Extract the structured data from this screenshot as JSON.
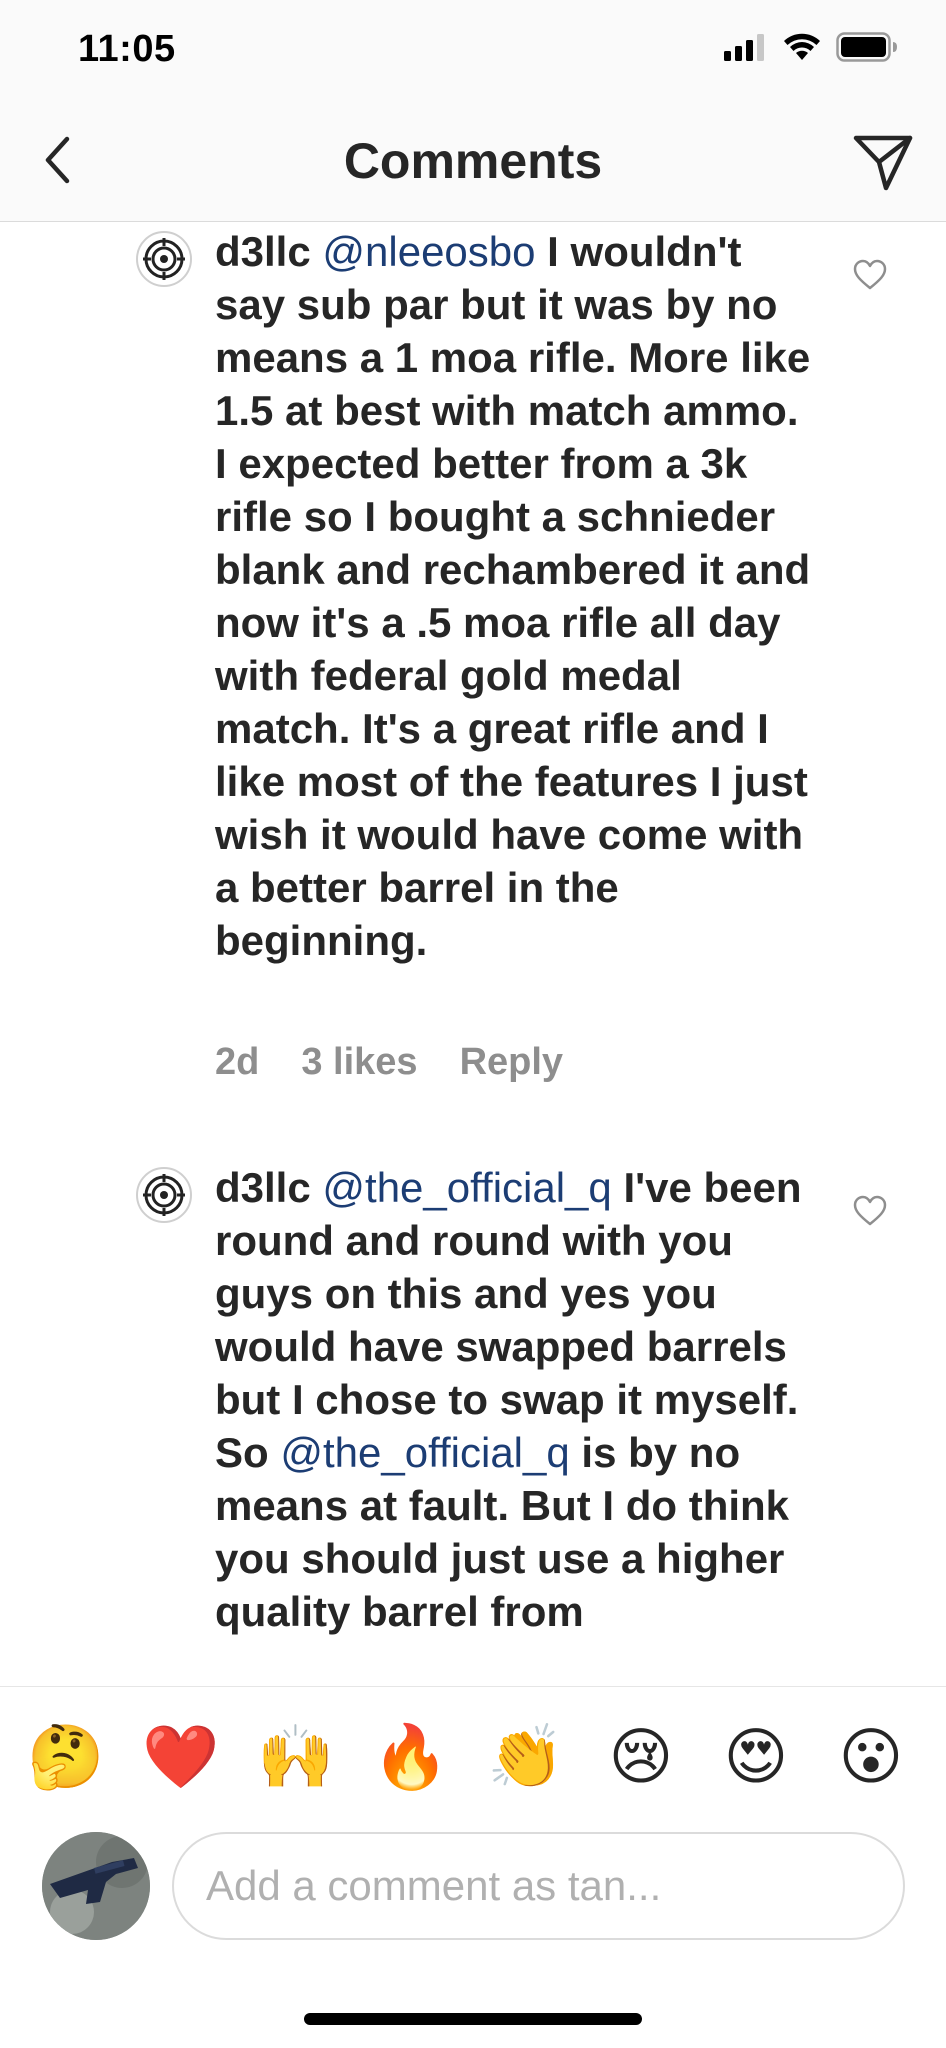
{
  "status_bar": {
    "time": "11:05"
  },
  "header": {
    "title": "Comments"
  },
  "comments": [
    {
      "username": "d3llc",
      "mention": "@nleeosbo",
      "text": " I wouldn't say sub par but it was by no means a 1 moa rifle.  More like 1.5 at best with match ammo.  I expected better from a 3k rifle so I bought a schnieder blank and rechambered it and now it's a .5 moa rifle all day with federal gold medal match.  It's a great rifle and I like most of the features I just wish it would have come with a better barrel in the beginning.",
      "age": "2d",
      "likes": "3 likes",
      "reply": "Reply"
    },
    {
      "username": "d3llc",
      "mention": "@the_official_q",
      "text_part1": " I've been round and round with you guys on this and yes you would have swapped barrels but I chose to swap it myself.  So ",
      "mention2": "@the_official_q",
      "text_part2": " is by no means at fault.  But I do think you should just use a higher quality barrel from"
    }
  ],
  "emoji_bar": [
    {
      "glyph": "🤔",
      "name": "thinking-face-emoji"
    },
    {
      "glyph": "❤️",
      "name": "red-heart-emoji"
    },
    {
      "glyph": "🙌",
      "name": "raising-hands-emoji"
    },
    {
      "glyph": "🔥",
      "name": "fire-emoji"
    },
    {
      "glyph": "👏",
      "name": "clapping-hands-emoji"
    },
    {
      "glyph": "😢",
      "name": "crying-face-emoji"
    },
    {
      "glyph": "😍",
      "name": "heart-eyes-emoji"
    },
    {
      "glyph": "😮",
      "name": "surprised-face-emoji"
    }
  ],
  "composer": {
    "placeholder": "Add a comment as tan..."
  },
  "colors": {
    "mention": "#1c3d74",
    "text": "#262626",
    "meta": "#8e8e8e",
    "bar_bg": "#fafafa"
  }
}
